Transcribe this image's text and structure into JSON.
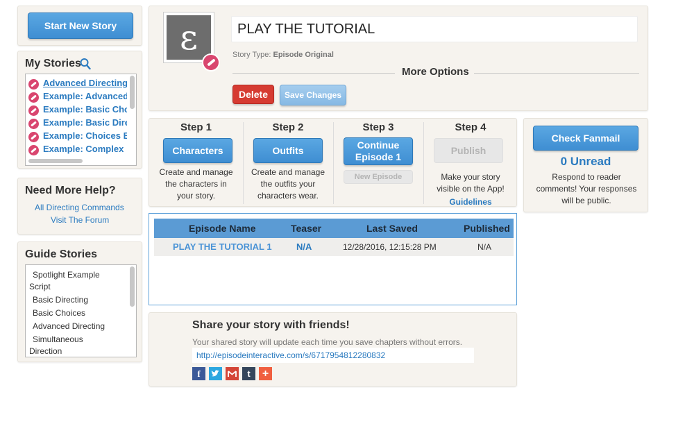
{
  "sidebar": {
    "start_button": "Start New Story",
    "my_stories": {
      "title": "My Stories",
      "items": [
        "Advanced Directing",
        "Example: Advanced",
        "Example: Basic Cho",
        "Example: Basic Dire",
        "Example: Choices B",
        "Example: Complex"
      ]
    },
    "help": {
      "title": "Need More Help?",
      "links": [
        "All Directing Commands",
        "Visit The Forum"
      ]
    },
    "guide_stories": {
      "title": "Guide Stories",
      "items": [
        "Spotlight Example",
        "Script",
        "Basic Directing",
        "Basic Choices",
        "Advanced Directing",
        "Simultaneous",
        "Direction"
      ]
    }
  },
  "story": {
    "logo_glyph": "ɛ",
    "title": "PLAY THE TUTORIAL",
    "type_label": "Story Type:",
    "type_value": "Episode Original",
    "more_options": "More Options",
    "delete_label": "Delete",
    "save_label": "Save Changes"
  },
  "steps": [
    {
      "title": "Step 1",
      "button": "Characters",
      "desc": "Create and manage the characters in your story."
    },
    {
      "title": "Step 2",
      "button": "Outfits",
      "desc": "Create and manage the outfits your characters wear."
    },
    {
      "title": "Step 3",
      "button": "Continue Episode 1",
      "secondary": "New Episode"
    },
    {
      "title": "Step 4",
      "button": "Publish",
      "desc": "Make your story visible on the App!",
      "link": "Guidelines"
    }
  ],
  "fanmail": {
    "button": "Check Fanmail",
    "unread": "0 Unread",
    "desc": "Respond to reader comments! Your responses will be public."
  },
  "episodes": {
    "columns": [
      "Episode Name",
      "Teaser",
      "Last Saved",
      "Published"
    ],
    "rows": [
      {
        "name": "PLAY THE TUTORIAL 1",
        "teaser": "N/A",
        "last_saved": "12/28/2016, 12:15:28 PM",
        "published": "N/A"
      }
    ]
  },
  "share": {
    "title": "Share your story with friends!",
    "desc": "Your shared story will update each time you save chapters without errors.",
    "url": "http://episodeinteractive.com/s/6717954812280832",
    "icons": [
      "facebook-icon",
      "twitter-icon",
      "gmail-icon",
      "tumblr-icon",
      "more-icon"
    ]
  },
  "colors": {
    "accent": "#3f8ed2",
    "link": "#2b7bc0",
    "delete": "#d63b32",
    "tag": "#d9466f"
  }
}
